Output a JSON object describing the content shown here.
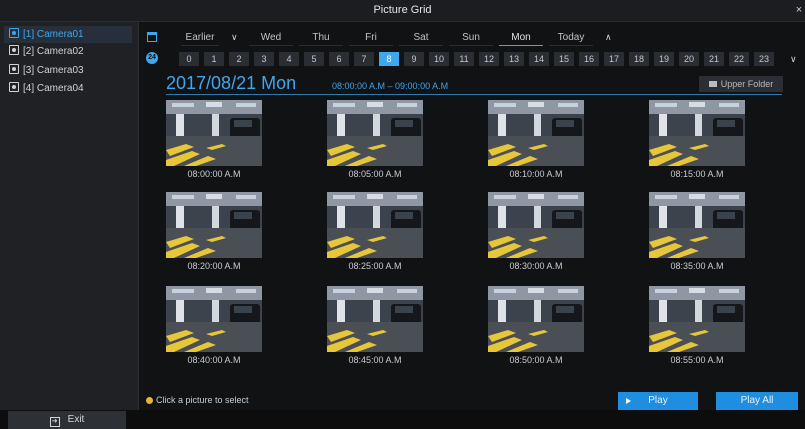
{
  "window": {
    "title": "Picture Grid",
    "close_glyph": "×"
  },
  "sidebar": {
    "cameras": [
      {
        "label": "[1] Camera01"
      },
      {
        "label": "[2] Camera02"
      },
      {
        "label": "[3] Camera03"
      },
      {
        "label": "[4] Camera04"
      }
    ],
    "active_camera": "[1] Camera01",
    "exit_label": "Exit"
  },
  "date_nav": {
    "earlier": "Earlier",
    "days": [
      "Wed",
      "Thu",
      "Fri",
      "Sat",
      "Sun",
      "Mon",
      "Today"
    ],
    "active_day": "Mon"
  },
  "hour_nav": {
    "hours": [
      "0",
      "1",
      "2",
      "3",
      "4",
      "5",
      "6",
      "7",
      "8",
      "9",
      "10",
      "11",
      "12",
      "13",
      "14",
      "15",
      "16",
      "17",
      "18",
      "19",
      "20",
      "21",
      "22",
      "23"
    ],
    "active_hour": "8",
    "icon_label": "24"
  },
  "header": {
    "date": "2017/08/21 Mon",
    "time_range": "08:00:00 A.M – 09:00:00 A.M",
    "upper_folder": "Upper Folder"
  },
  "thumbnails": [
    {
      "time": "08:00:00 A.M"
    },
    {
      "time": "08:05:00 A.M"
    },
    {
      "time": "08:10:00 A.M"
    },
    {
      "time": "08:15:00 A.M"
    },
    {
      "time": "08:20:00 A.M"
    },
    {
      "time": "08:25:00 A.M"
    },
    {
      "time": "08:30:00 A.M"
    },
    {
      "time": "08:35:00 A.M"
    },
    {
      "time": "08:40:00 A.M"
    },
    {
      "time": "08:45:00 A.M"
    },
    {
      "time": "08:50:00 A.M"
    },
    {
      "time": "08:55:00 A.M"
    }
  ],
  "footer": {
    "hint": "Click a picture to select",
    "play": "Play",
    "play_all": "Play All"
  },
  "colors": {
    "accent": "#3ea7ee",
    "button": "#1f8de0"
  }
}
